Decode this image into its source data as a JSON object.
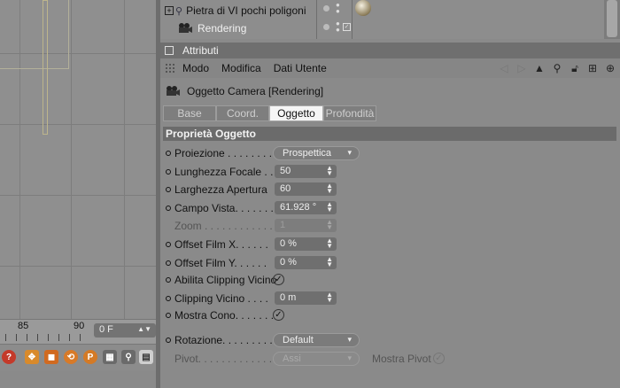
{
  "object_manager": {
    "items": [
      {
        "name": "Pietra di VI pochi poligoni",
        "selected": false
      },
      {
        "name": "Rendering",
        "selected": true
      }
    ]
  },
  "attributes": {
    "header": "Attributi",
    "menu": [
      "Modo",
      "Modifica",
      "Dati Utente"
    ],
    "object_title": "Oggetto Camera [Rendering]",
    "tabs": [
      "Base",
      "Coord.",
      "Oggetto",
      "Profondità"
    ],
    "active_tab": "Oggetto",
    "section": "Proprietà Oggetto",
    "properties": {
      "proiezione": {
        "label": "Proiezione . . . . . . . .",
        "value": "Prospettica"
      },
      "lunghezza_focale": {
        "label": "Lunghezza Focale . .",
        "value": "50"
      },
      "larghezza_apertura": {
        "label": "Larghezza Apertura",
        "value": "60"
      },
      "campo_vista": {
        "label": "Campo Vista. . . . . . .",
        "value": "61.928 °"
      },
      "zoom": {
        "label": "Zoom . . . . . . . . . . . .",
        "value": "1"
      },
      "offset_x": {
        "label": "Offset Film X. . . . . .",
        "value": "0 %"
      },
      "offset_y": {
        "label": "Offset Film Y. . . . . .",
        "value": "0 %"
      },
      "abilita_clipping": {
        "label": "Abilita Clipping Vicino"
      },
      "clipping_vicino": {
        "label": "Clipping Vicino . . . .",
        "value": "0 m"
      },
      "mostra_cono": {
        "label": "Mostra Cono. . . . . . ."
      },
      "rotazione": {
        "label": "Rotazione. . . . . . . . . .",
        "value": "Default"
      },
      "pivot": {
        "label": "Pivot. . . . . . . . . . . . . .",
        "value": "Assi"
      },
      "mostra_pivot": {
        "label": "Mostra Pivot"
      }
    }
  },
  "timeline": {
    "labels": [
      "85",
      "90"
    ],
    "frame_value": "0 F"
  }
}
